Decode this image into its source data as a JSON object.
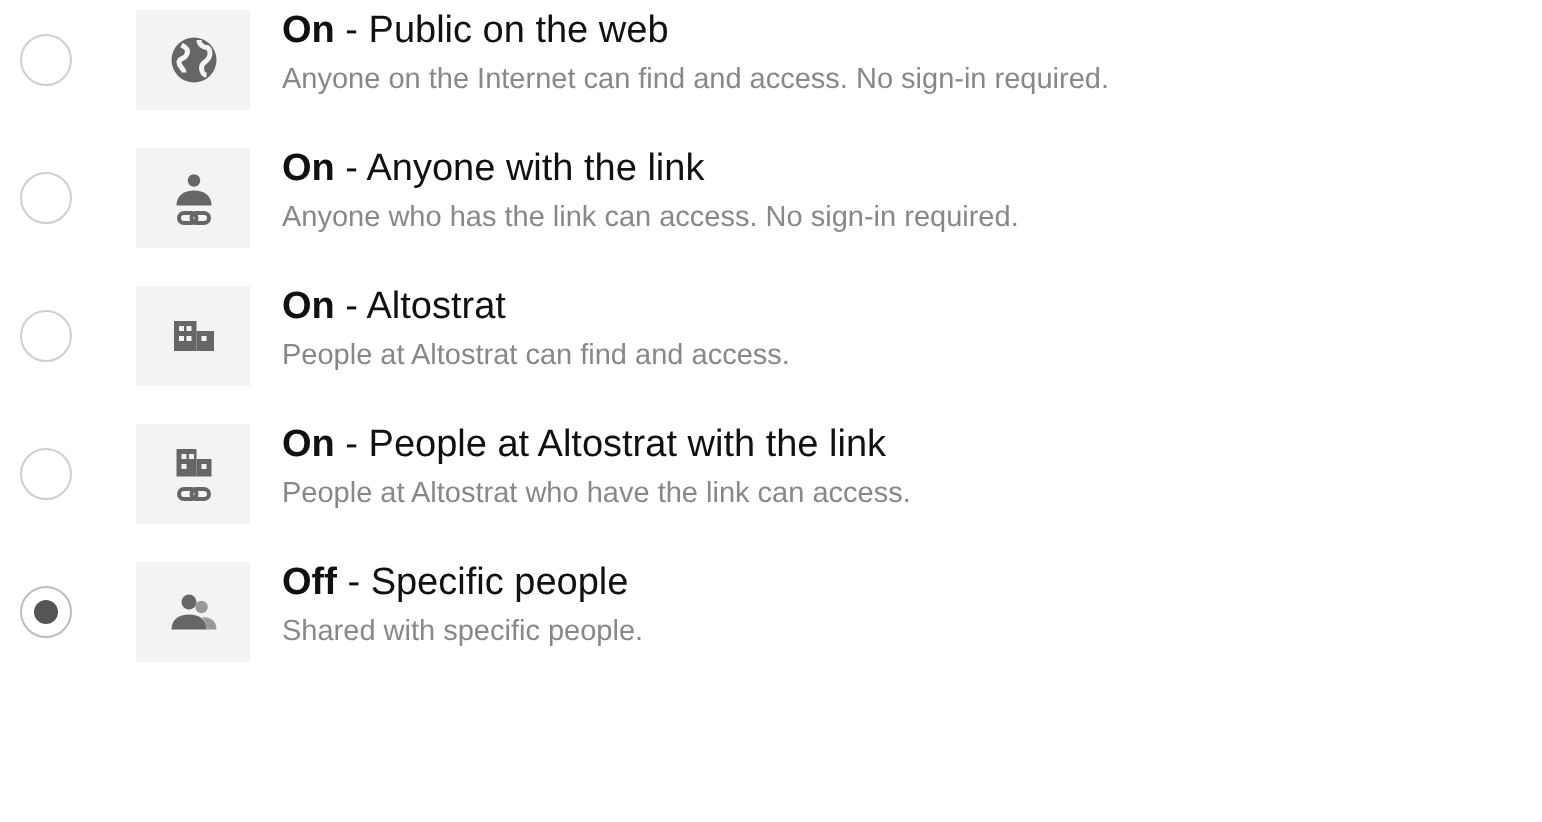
{
  "options": [
    {
      "kind": "globe",
      "title": "**On** - Public on the web",
      "description": "Anyone on the Internet can find and access. No sign-in required.",
      "selected": false
    },
    {
      "kind": "person-link",
      "title": "**On** - Anyone with the link",
      "description": "Anyone who has the link can access. No sign-in required.",
      "selected": false
    },
    {
      "kind": "building",
      "title": "**On** - Altostrat",
      "description": "People at Altostrat can find and access.",
      "selected": false
    },
    {
      "kind": "building-link",
      "title": "**On** - People at Altostrat with the link",
      "description": "People at Altostrat who have the link can access.",
      "selected": false
    },
    {
      "kind": "people",
      "title": "**Off** - Specific people",
      "description": "Shared with specific people.",
      "selected": true
    }
  ]
}
